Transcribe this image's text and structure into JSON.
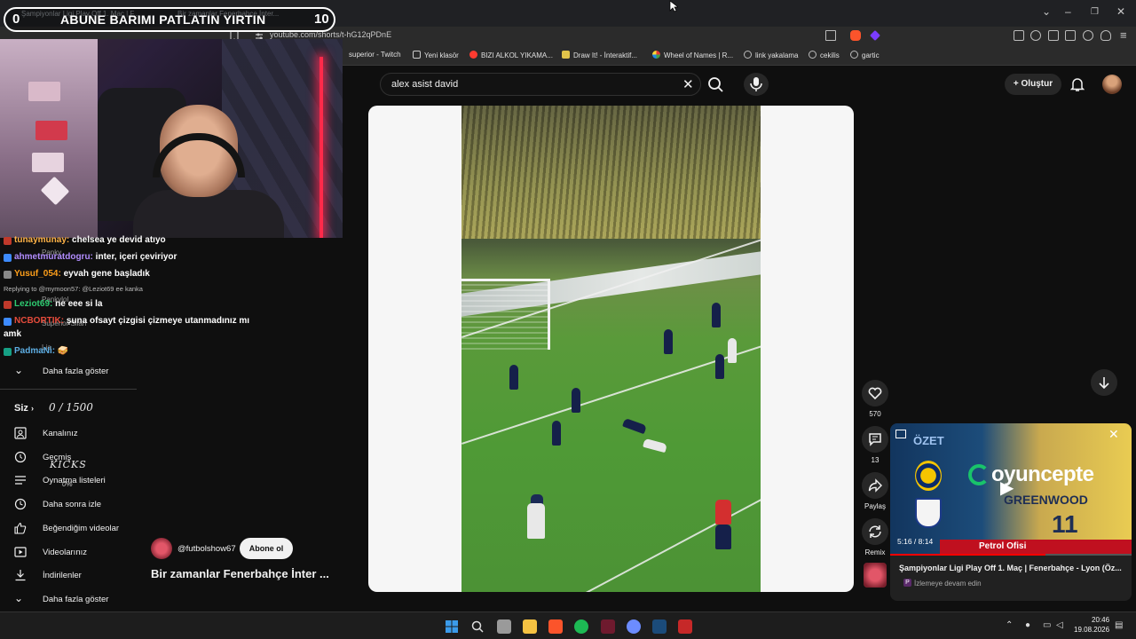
{
  "browser": {
    "tabs": [
      {
        "label": "Şampiyonlar Ligi Play Off 1. Maç | F..."
      },
      {
        "label": "Bir zamanlar Fenerbahçe İnter..."
      }
    ],
    "url": "youtube.com/shorts/t-hG12qPDnE",
    "bookmarks": [
      {
        "label": "superior - Twitch",
        "color": "#9146ff"
      },
      {
        "label": "Yeni klasör",
        "color": "#cccccc"
      },
      {
        "label": "BIZI ALKOL YIKAMA...",
        "color": "#ff3b30"
      },
      {
        "label": "Draw It! - İnteraktif...",
        "color": "#e0c34a"
      },
      {
        "label": "Wheel of Names | R...",
        "color": "#4caf50"
      },
      {
        "label": "link yakalama",
        "color": "#bbbbbb"
      },
      {
        "label": "cekilis",
        "color": "#bbbbbb"
      },
      {
        "label": "gartic",
        "color": "#bbbbbb"
      }
    ]
  },
  "overlay": {
    "left_count": "0",
    "title": "ABUNE BARIMI PATLATIN YIRTIN",
    "right_count": "10"
  },
  "header": {
    "search_value": "alex asist david",
    "create_label": "Oluştur"
  },
  "chat": {
    "messages": [
      {
        "user": "tunaymunay:",
        "text": " chelsea ye devid atıyo",
        "color": "#ffb347",
        "badge": "#c0392b"
      },
      {
        "user": "ahmetmuratdogru:",
        "text": " inter, içeri çeviriyor",
        "color": "#b28dff",
        "badge": "#3d8bff"
      },
      {
        "user": "Yusuf_054:",
        "text": " eyvah gene başladık",
        "color": "#ff9f1a",
        "badge": "#888888"
      },
      {
        "user": "Leziot69:",
        "text": " ne eee si la",
        "color": "#2ecc71",
        "badge": "#c0392b"
      },
      {
        "user": "NCBORTIK:",
        "text": " şuna ofsayt çizgisi çizmeye utanmadınız mı",
        "color": "#e74c3c",
        "badge": "#3d8bff"
      },
      {
        "user": "PadmaNi:",
        "text": " 🥪",
        "color": "#5dade2",
        "badge": "#16a085"
      }
    ],
    "wrap_text": "amk",
    "reply_text": "Replying to @mymoon57: @Leziot69 ee kanka",
    "ghost_labels": [
      "Pankv",
      "Pankvlol",
      "Superior Silah",
      "Lia"
    ]
  },
  "sidebar": {
    "more_label_1": "Daha fazla göster",
    "you_label": "Siz",
    "counter": "0 / 1500",
    "kicks_label": "KICKS",
    "kicks_pct": "0%",
    "items": [
      {
        "label": "Kanalınız"
      },
      {
        "label": "Geçmiş"
      },
      {
        "label": "Oynatma listeleri"
      },
      {
        "label": "Daha sonra izle"
      },
      {
        "label": "Beğendiğim videolar"
      },
      {
        "label": "Videolarınız"
      },
      {
        "label": "İndirilenler"
      },
      {
        "label": "Daha fazla göster"
      }
    ]
  },
  "short": {
    "channel": "@futbolshow67",
    "subscribe_label": "Abone ol",
    "title": "Bir zamanlar Fenerbahçe İnter ...",
    "likes": "570",
    "comments": "13",
    "share_label": "Paylaş",
    "remix_label": "Remix"
  },
  "miniplayer": {
    "tag": "ÖZET",
    "brand": "oyuncepte",
    "shirt_name": "GREENWOOD",
    "shirt_number": "11",
    "sponsor": "Petrol Ofisi",
    "time": "5:16 / 8:14",
    "progress_fraction": 0.645,
    "title": "Şampiyonlar Ligi Play Off 1. Maç | Fenerbahçe - Lyon (Öz...",
    "subtitle": "İzlemeye devam edin"
  },
  "taskbar": {
    "time": "20:46",
    "date": "19.08.2026"
  }
}
